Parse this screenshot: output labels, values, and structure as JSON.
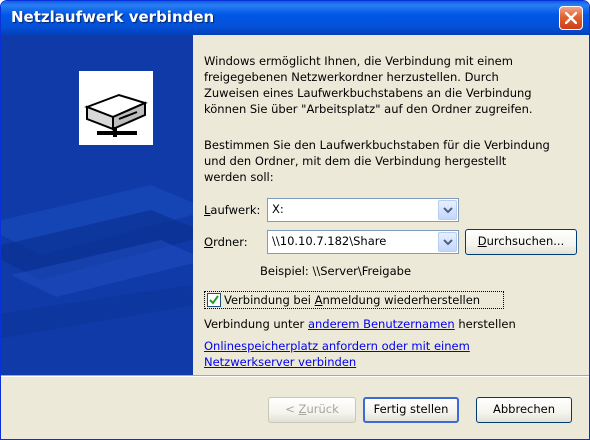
{
  "window": {
    "title": "Netzlaufwerk verbinden"
  },
  "intro": {
    "lines": [
      "Windows ermöglicht Ihnen, die Verbindung mit einem",
      "freigegebenen Netzwerkordner herzustellen. Durch",
      "Zuweisen eines Laufwerkbuchstabens an die Verbindung",
      "können Sie über \"Arbeitsplatz\" auf den Ordner zugreifen."
    ]
  },
  "instructions": {
    "lines": [
      "Bestimmen Sie den Laufwerkbuchstaben für die Verbindung",
      "und den Ordner, mit dem die Verbindung hergestellt",
      "werden soll:"
    ]
  },
  "drive": {
    "label_accel": "L",
    "label_rest": "aufwerk:",
    "value": "X:"
  },
  "folder": {
    "label_accel": "O",
    "label_rest": "rdner:",
    "value": "\\\\10.10.7.182\\Share"
  },
  "browse": {
    "accel": "D",
    "rest": "urchsuchen..."
  },
  "example": "Beispiel: \\\\Server\\Freigabe",
  "reconnect": {
    "checked": true,
    "before": "Verbindung bei ",
    "accel": "A",
    "after": "nmeldung wiederherstellen"
  },
  "other_user": {
    "prefix": "Verbindung unter ",
    "link": "anderem Benutzernamen",
    "suffix": " herstellen"
  },
  "online_link": {
    "line1": "Onlinespeicherplatz anfordern oder mit einem",
    "line2": "Netzwerkserver verbinden"
  },
  "buttons": {
    "back_prefix": "< ",
    "back_accel": "Z",
    "back_rest": "urück",
    "finish": "Fertig stellen",
    "cancel": "Abbrechen"
  },
  "colors": {
    "titlebar": "#0058e6",
    "side_panel": "#0f3aa8",
    "dialog_bg": "#ece9d8",
    "close_button": "#e3602f",
    "link": "#0000ee"
  },
  "icons": {
    "close": "close-icon",
    "drive": "network-drive-icon",
    "combo_arrow": "chevron-down-icon",
    "check": "checkmark-icon"
  }
}
